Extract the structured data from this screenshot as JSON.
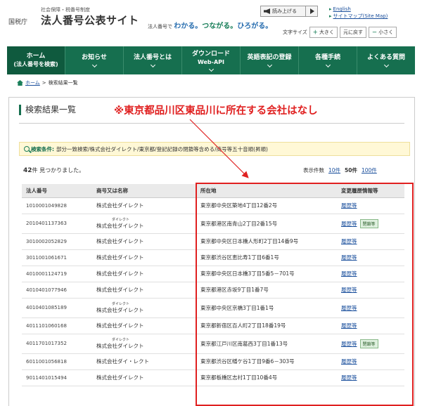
{
  "header": {
    "brand_sub": "社会保障・税番号制度",
    "brand_org": "国税庁",
    "brand_main": "法人番号公表サイト",
    "slogan_prefix": "法人番号で",
    "slogan_1": "わかる。",
    "slogan_2": "つながる。",
    "slogan_3": "ひろがる。",
    "read_label": "読み上げる",
    "link_english": "English",
    "link_sitemap": "サイトマップ(Site Map)",
    "font_size_label": "文字サイズ",
    "font_bigger": "大きく",
    "font_reset": "元に戻す",
    "font_smaller": "小さく"
  },
  "nav": [
    {
      "label": "ホーム",
      "sub": "(法人番号を検索)"
    },
    {
      "label": "お知らせ",
      "sub": ""
    },
    {
      "label": "法人番号とは",
      "sub": ""
    },
    {
      "label": "ダウンロード",
      "sub": "Web-API"
    },
    {
      "label": "英語表記の登録",
      "sub": ""
    },
    {
      "label": "各種手続",
      "sub": ""
    },
    {
      "label": "よくある質問",
      "sub": ""
    }
  ],
  "breadcrumb": {
    "home": "ホーム",
    "current": "検索結果一覧",
    "sep": ">"
  },
  "page_title": "検索結果一覧",
  "annotation": "※東京都品川区東品川に所在する会社はなし",
  "conditions": {
    "label": "検索条件:",
    "text": "部分一致検索/株式会社ダイレクト/東京都/登記記録の閉鎖等含める/商号等五十音順(昇順)"
  },
  "results": {
    "count": "42",
    "suffix": "件 見つかりました。"
  },
  "paging": {
    "label": "表示件数",
    "opt1": "10件",
    "opt2": "50件",
    "opt3": "100件"
  },
  "table": {
    "headers": [
      "法人番号",
      "商号又は名称",
      "所在地",
      "変更履歴情報等"
    ],
    "rows": [
      {
        "num": "1010001049828",
        "ruby": "",
        "name": "株式会社ダイレクト",
        "addr": "東京都中央区築地4丁目12番2号",
        "link": "履歴等",
        "badge": ""
      },
      {
        "num": "2010401137363",
        "ruby": "ダイレクト",
        "name": "株式会社ダイレクト",
        "addr": "東京都港区南青山2丁目2番15号",
        "link": "履歴等",
        "badge": "閉鎖等"
      },
      {
        "num": "3010002052829",
        "ruby": "",
        "name": "株式会社ダイレクト",
        "addr": "東京都中央区日本橋人形町2丁目14番9号",
        "link": "履歴等",
        "badge": ""
      },
      {
        "num": "3011001061671",
        "ruby": "",
        "name": "株式会社ダイレクト",
        "addr": "東京都渋谷区恵比寿1丁目6番1号",
        "link": "履歴等",
        "badge": ""
      },
      {
        "num": "4010001124719",
        "ruby": "",
        "name": "株式会社ダイレクト",
        "addr": "東京都中央区日本橋3丁目5番5－701号",
        "link": "履歴等",
        "badge": ""
      },
      {
        "num": "4010401077946",
        "ruby": "",
        "name": "株式会社ダイレクト",
        "addr": "東京都港区赤坂9丁目1番7号",
        "link": "履歴等",
        "badge": ""
      },
      {
        "num": "4010401085189",
        "ruby": "ダイレクト",
        "name": "株式会社ダイレクト",
        "addr": "東京都中央区京橋3丁目1番1号",
        "link": "履歴等",
        "badge": ""
      },
      {
        "num": "4011101060168",
        "ruby": "",
        "name": "株式会社ダイレクト",
        "addr": "東京都新宿区百人町2丁目18番19号",
        "link": "履歴等",
        "badge": ""
      },
      {
        "num": "4011701017352",
        "ruby": "ダイレクト",
        "name": "株式会社ダイレクト",
        "addr": "東京都江戸川区南葛西3丁目1番13号",
        "link": "履歴等",
        "badge": "閉鎖等"
      },
      {
        "num": "6011001056818",
        "ruby": "",
        "name": "株式会社ダイ・レクト",
        "addr": "東京都渋谷区幡ケ谷1丁目9番6－303号",
        "link": "履歴等",
        "badge": ""
      },
      {
        "num": "9011401015494",
        "ruby": "",
        "name": "株式会社ダイレクト",
        "addr": "東京都板橋区志村1丁目10番4号",
        "link": "履歴等",
        "badge": ""
      }
    ]
  }
}
